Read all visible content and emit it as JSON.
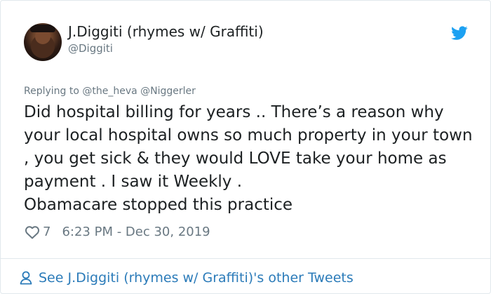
{
  "author": {
    "display_name": "J.Diggiti (rhymes w/ Graffiti)",
    "username": "@Diggiti"
  },
  "reply_context": "Replying to @the_heva @Niggerler",
  "tweet": {
    "text": "Did hospital billing for years .. There’s a reason why your local hospital owns so much property in your town , you get sick & they would LOVE take your home as payment . I saw it Weekly .\nObamacare stopped this practice",
    "like_count": "7",
    "timestamp": "6:23 PM - Dec 30, 2019"
  },
  "footer": {
    "link_text": "See J.Diggiti (rhymes w/ Graffiti)'s other Tweets"
  },
  "icons": {
    "twitter": "twitter-bird-icon",
    "like": "heart-icon",
    "profile": "person-icon"
  },
  "colors": {
    "twitter_blue": "#1da1f2",
    "link_blue": "#2b7bb9",
    "muted_gray": "#697882",
    "text_dark": "#1c2022",
    "border": "#e1e8ed"
  }
}
